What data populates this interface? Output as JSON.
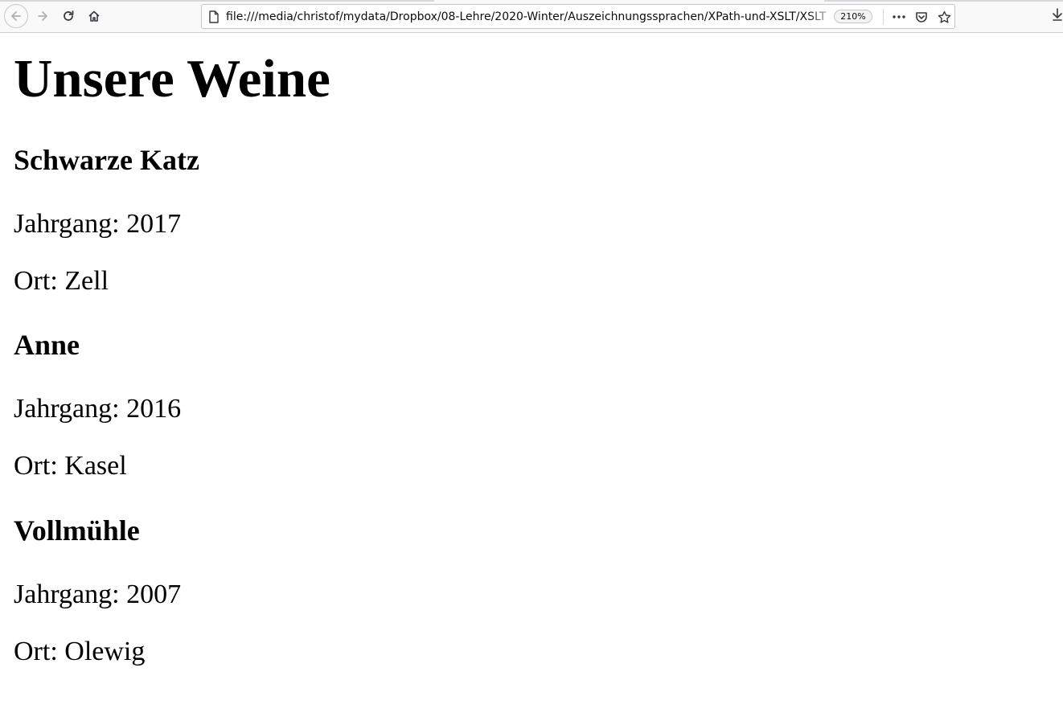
{
  "browser": {
    "url": "file:///media/christof/mydata/Dropbox/08-Lehre/2020-Winter/Auszeichnungssprachen/XPath-und-XSLT/XSLT",
    "zoom": "210%"
  },
  "page": {
    "title": "Unsere Weine",
    "wines": [
      {
        "name": "Schwarze Katz",
        "jahrgang": "Jahrgang: 2017",
        "ort": "Ort: Zell"
      },
      {
        "name": "Anne",
        "jahrgang": "Jahrgang: 2016",
        "ort": "Ort: Kasel"
      },
      {
        "name": "Vollmühle",
        "jahrgang": "Jahrgang: 2007",
        "ort": "Ort: Olewig"
      }
    ]
  }
}
